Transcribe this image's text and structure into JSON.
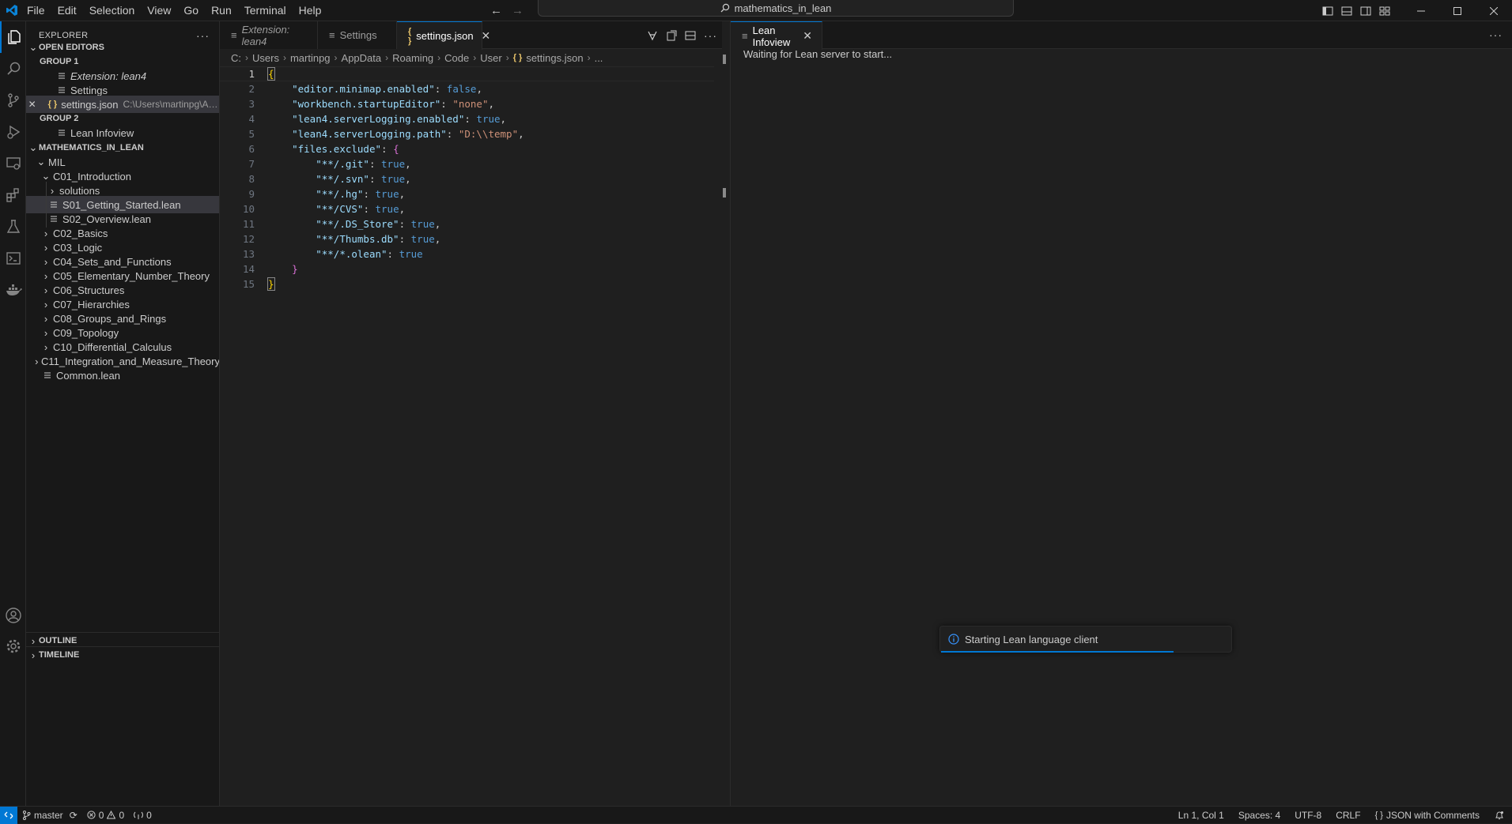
{
  "menu": [
    "File",
    "Edit",
    "Selection",
    "View",
    "Go",
    "Run",
    "Terminal",
    "Help"
  ],
  "command_center": "mathematics_in_lean",
  "explorer": {
    "title": "EXPLORER",
    "open_editors": "OPEN EDITORS",
    "group1": "GROUP 1",
    "group1_items": [
      "Extension: lean4",
      "Settings",
      "settings.json"
    ],
    "settings_path": "C:\\Users\\martinpg\\AppData\\...",
    "group2": "GROUP 2",
    "group2_items": [
      "Lean Infoview"
    ],
    "workspace": "MATHEMATICS_IN_LEAN",
    "tree": {
      "root": "MIL",
      "c01": "C01_Introduction",
      "c01_children": [
        "solutions",
        "S01_Getting_Started.lean",
        "S02_Overview.lean"
      ],
      "folders": [
        "C02_Basics",
        "C03_Logic",
        "C04_Sets_and_Functions",
        "C05_Elementary_Number_Theory",
        "C06_Structures",
        "C07_Hierarchies",
        "C08_Groups_and_Rings",
        "C09_Topology",
        "C10_Differential_Calculus",
        "C11_Integration_and_Measure_Theory"
      ],
      "common": "Common.lean"
    },
    "outline": "OUTLINE",
    "timeline": "TIMELINE"
  },
  "editor1": {
    "tabs": [
      "Extension: lean4",
      "Settings",
      "settings.json"
    ],
    "breadcrumb": [
      "C:",
      "Users",
      "martinpg",
      "AppData",
      "Roaming",
      "Code",
      "User",
      "settings.json",
      "..."
    ],
    "line_numbers": [
      "1",
      "2",
      "3",
      "4",
      "5",
      "6",
      "7",
      "8",
      "9",
      "10",
      "11",
      "12",
      "13",
      "14",
      "15"
    ],
    "code": {
      "l1": "{",
      "l2_key": "\"editor.minimap.enabled\"",
      "l2_val": "false",
      "l3_key": "\"workbench.startupEditor\"",
      "l3_val": "\"none\"",
      "l4_key": "\"lean4.serverLogging.enabled\"",
      "l4_val": "true",
      "l5_key": "\"lean4.serverLogging.path\"",
      "l5_val": "\"D:\\\\temp\"",
      "l6_key": "\"files.exclude\"",
      "l6_brace": "{",
      "l7_key": "\"**/.git\"",
      "l7_val": "true",
      "l8_key": "\"**/.svn\"",
      "l8_val": "true",
      "l9_key": "\"**/.hg\"",
      "l9_val": "true",
      "l10_key": "\"**/CVS\"",
      "l10_val": "true",
      "l11_key": "\"**/.DS_Store\"",
      "l11_val": "true",
      "l12_key": "\"**/Thumbs.db\"",
      "l12_val": "true",
      "l13_key": "\"**/*.olean\"",
      "l13_val": "true",
      "l14": "}",
      "l15": "}"
    }
  },
  "editor2": {
    "tab": "Lean Infoview",
    "message": "Waiting for Lean server to start..."
  },
  "notification": "Starting Lean language client",
  "statusbar": {
    "branch": "master",
    "errors": "0",
    "warnings": "0",
    "ports": "0",
    "position": "Ln 1, Col 1",
    "spaces": "Spaces: 4",
    "encoding": "UTF-8",
    "eol": "CRLF",
    "language": "JSON with Comments"
  },
  "colors": {
    "accent": "#0078d4",
    "key": "#9cdcfe",
    "string": "#ce9178",
    "boolean": "#569cd6",
    "bracket1": "#ffd700",
    "bracket2": "#da70d6"
  }
}
